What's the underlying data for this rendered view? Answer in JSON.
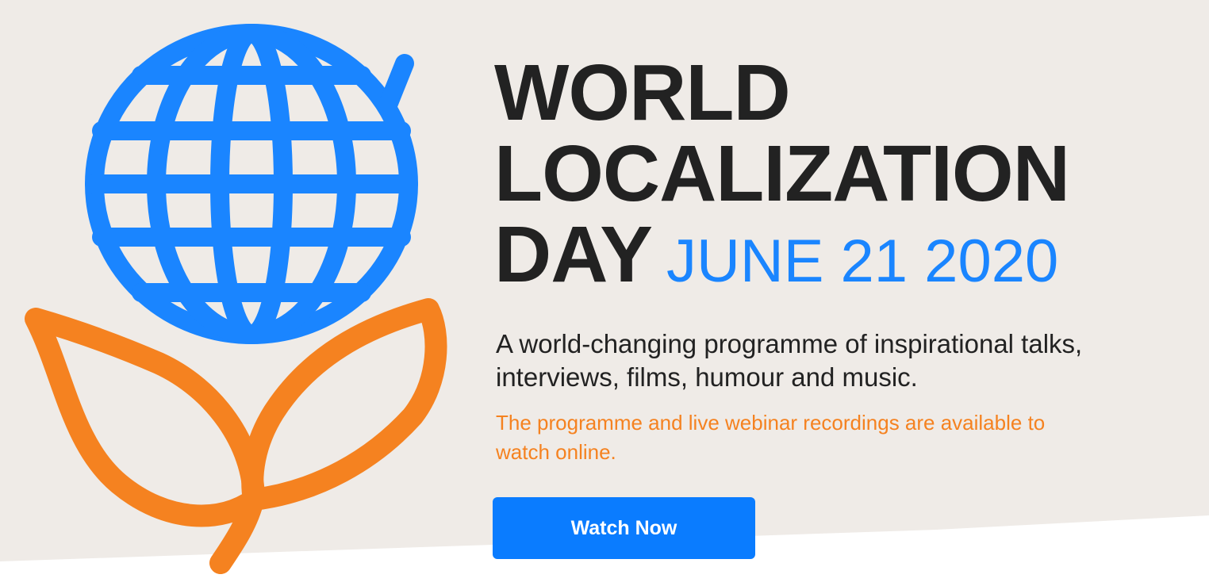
{
  "hero": {
    "title_line1": "WORLD",
    "title_line2": "LOCALIZATION",
    "title_line3": "DAY",
    "date": "JUNE 21 2020",
    "lead": "A world-changing programme of inspirational talks, interviews, films, humour and music.",
    "note": "The programme and live webinar recordings are available to watch online.",
    "cta_label": "Watch Now"
  },
  "colors": {
    "background": "#efebe7",
    "title": "#222222",
    "accent_blue": "#1a85ff",
    "accent_orange": "#f58220",
    "button": "#0a7cff"
  },
  "icons": [
    "globe-icon",
    "leaf-stem-icon"
  ]
}
